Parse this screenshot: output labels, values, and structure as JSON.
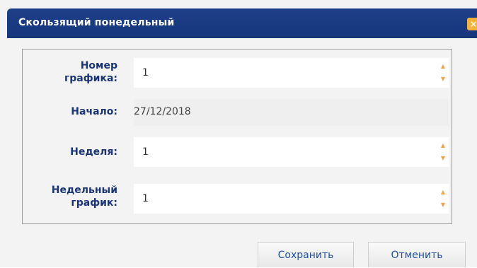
{
  "dialog": {
    "title": "Скользящий понедельный",
    "close_icon_glyph": "×"
  },
  "form": {
    "schedule_number": {
      "label": "Номер графика:",
      "value": "1"
    },
    "start": {
      "label": "Начало:",
      "value": "27/12/2018"
    },
    "week": {
      "label": "Неделя:",
      "value": "1"
    },
    "weekly_schedule": {
      "label": "Недельный график:",
      "value": "1"
    }
  },
  "buttons": {
    "save_label": "Сохранить",
    "cancel_label": "Отменить"
  },
  "colors": {
    "titlebar": "#1d3f88",
    "label": "#1c3577",
    "accent": "#f3a44a",
    "button_text": "#1f4fa3"
  }
}
